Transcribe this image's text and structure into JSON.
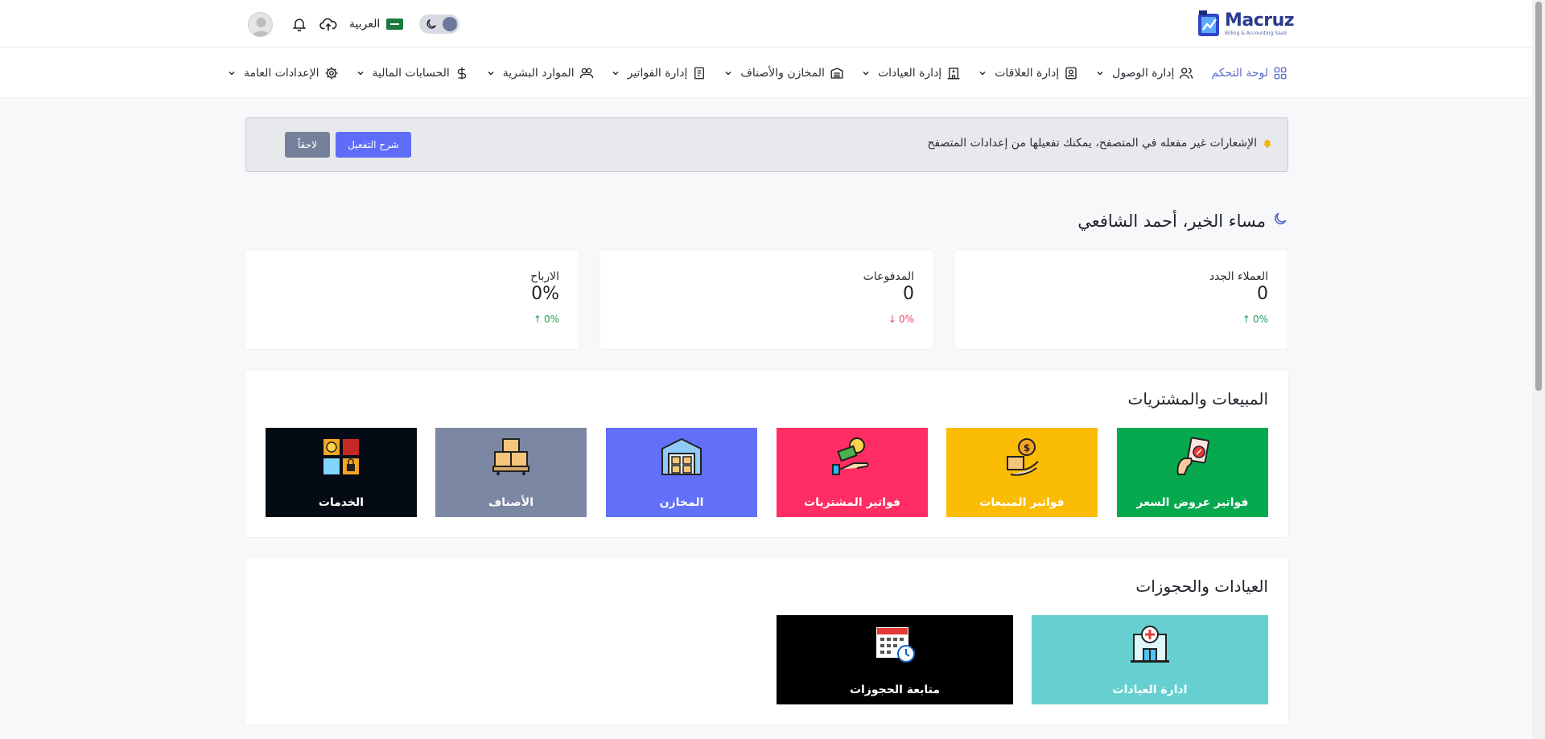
{
  "header": {
    "logo_name": "Macruz",
    "logo_sub": "Billing & Accounting SaaS",
    "language": "العربية"
  },
  "nav": [
    {
      "label": "لوحة التحكم",
      "icon": "dashboard-icon",
      "active": true,
      "dropdown": false
    },
    {
      "label": "إدارة الوصول",
      "icon": "users-icon",
      "dropdown": true
    },
    {
      "label": "إدارة العلاقات",
      "icon": "contact-card-icon",
      "dropdown": true
    },
    {
      "label": "إدارة العيادات",
      "icon": "clinic-building-icon",
      "dropdown": true
    },
    {
      "label": "المخازن والأصناف",
      "icon": "warehouse-icon",
      "dropdown": true
    },
    {
      "label": "إدارة الفواتير",
      "icon": "invoice-icon",
      "dropdown": true
    },
    {
      "label": "الموارد البشرية",
      "icon": "people-icon",
      "dropdown": true
    },
    {
      "label": "الحسابات المالية",
      "icon": "dollar-icon",
      "dropdown": true
    },
    {
      "label": "الإعدادات العامة",
      "icon": "gear-icon",
      "dropdown": true
    }
  ],
  "alert": {
    "text": "الإشعارات غير مفعله في المتصفح، يمكنك تفعيلها من إعدادات المتصفح",
    "activate_label": "شرح التفعيل",
    "later_label": "لاحقاً"
  },
  "greeting": "مساء الخير، أحمد الشافعي",
  "stats": [
    {
      "title": "العملاء الجدد",
      "value": "0",
      "change": "0%",
      "direction": "up"
    },
    {
      "title": "المدفوعات",
      "value": "0",
      "change": "0%",
      "direction": "down"
    },
    {
      "title": "الارباح",
      "value": "0%",
      "change": "0%",
      "direction": "up"
    }
  ],
  "sales_section": {
    "title": "المبيعات والمشتريات",
    "tiles": [
      {
        "label": "فواتير عروض السعر",
        "color": "#07a94f",
        "icon": "price-quote-icon"
      },
      {
        "label": "فواتير المبيعات",
        "color": "#fbbc05",
        "icon": "sales-invoice-icon"
      },
      {
        "label": "فواتير المشتريات",
        "color": "#ff2d63",
        "icon": "purchase-invoice-icon"
      },
      {
        "label": "المخازن",
        "color": "#626ff7",
        "icon": "warehouse-icon"
      },
      {
        "label": "الأصناف",
        "color": "#7c87a3",
        "icon": "boxes-icon"
      },
      {
        "label": "الخدمات",
        "color": "#050b14",
        "icon": "services-icon"
      }
    ]
  },
  "clinics_section": {
    "title": "العيادات والحجوزات",
    "tiles": [
      {
        "label": "ادارة العيادات",
        "color": "#66d0d0",
        "icon": "hospital-icon"
      },
      {
        "label": "متابعة الحجوزات",
        "color": "#000000",
        "icon": "calendar-clock-icon"
      }
    ]
  },
  "colors": {
    "accent": "#5b6ad0",
    "primary_button": "#5f6cf7",
    "secondary_button": "#75809a",
    "up": "#1f9d55",
    "down": "#e0476b"
  }
}
